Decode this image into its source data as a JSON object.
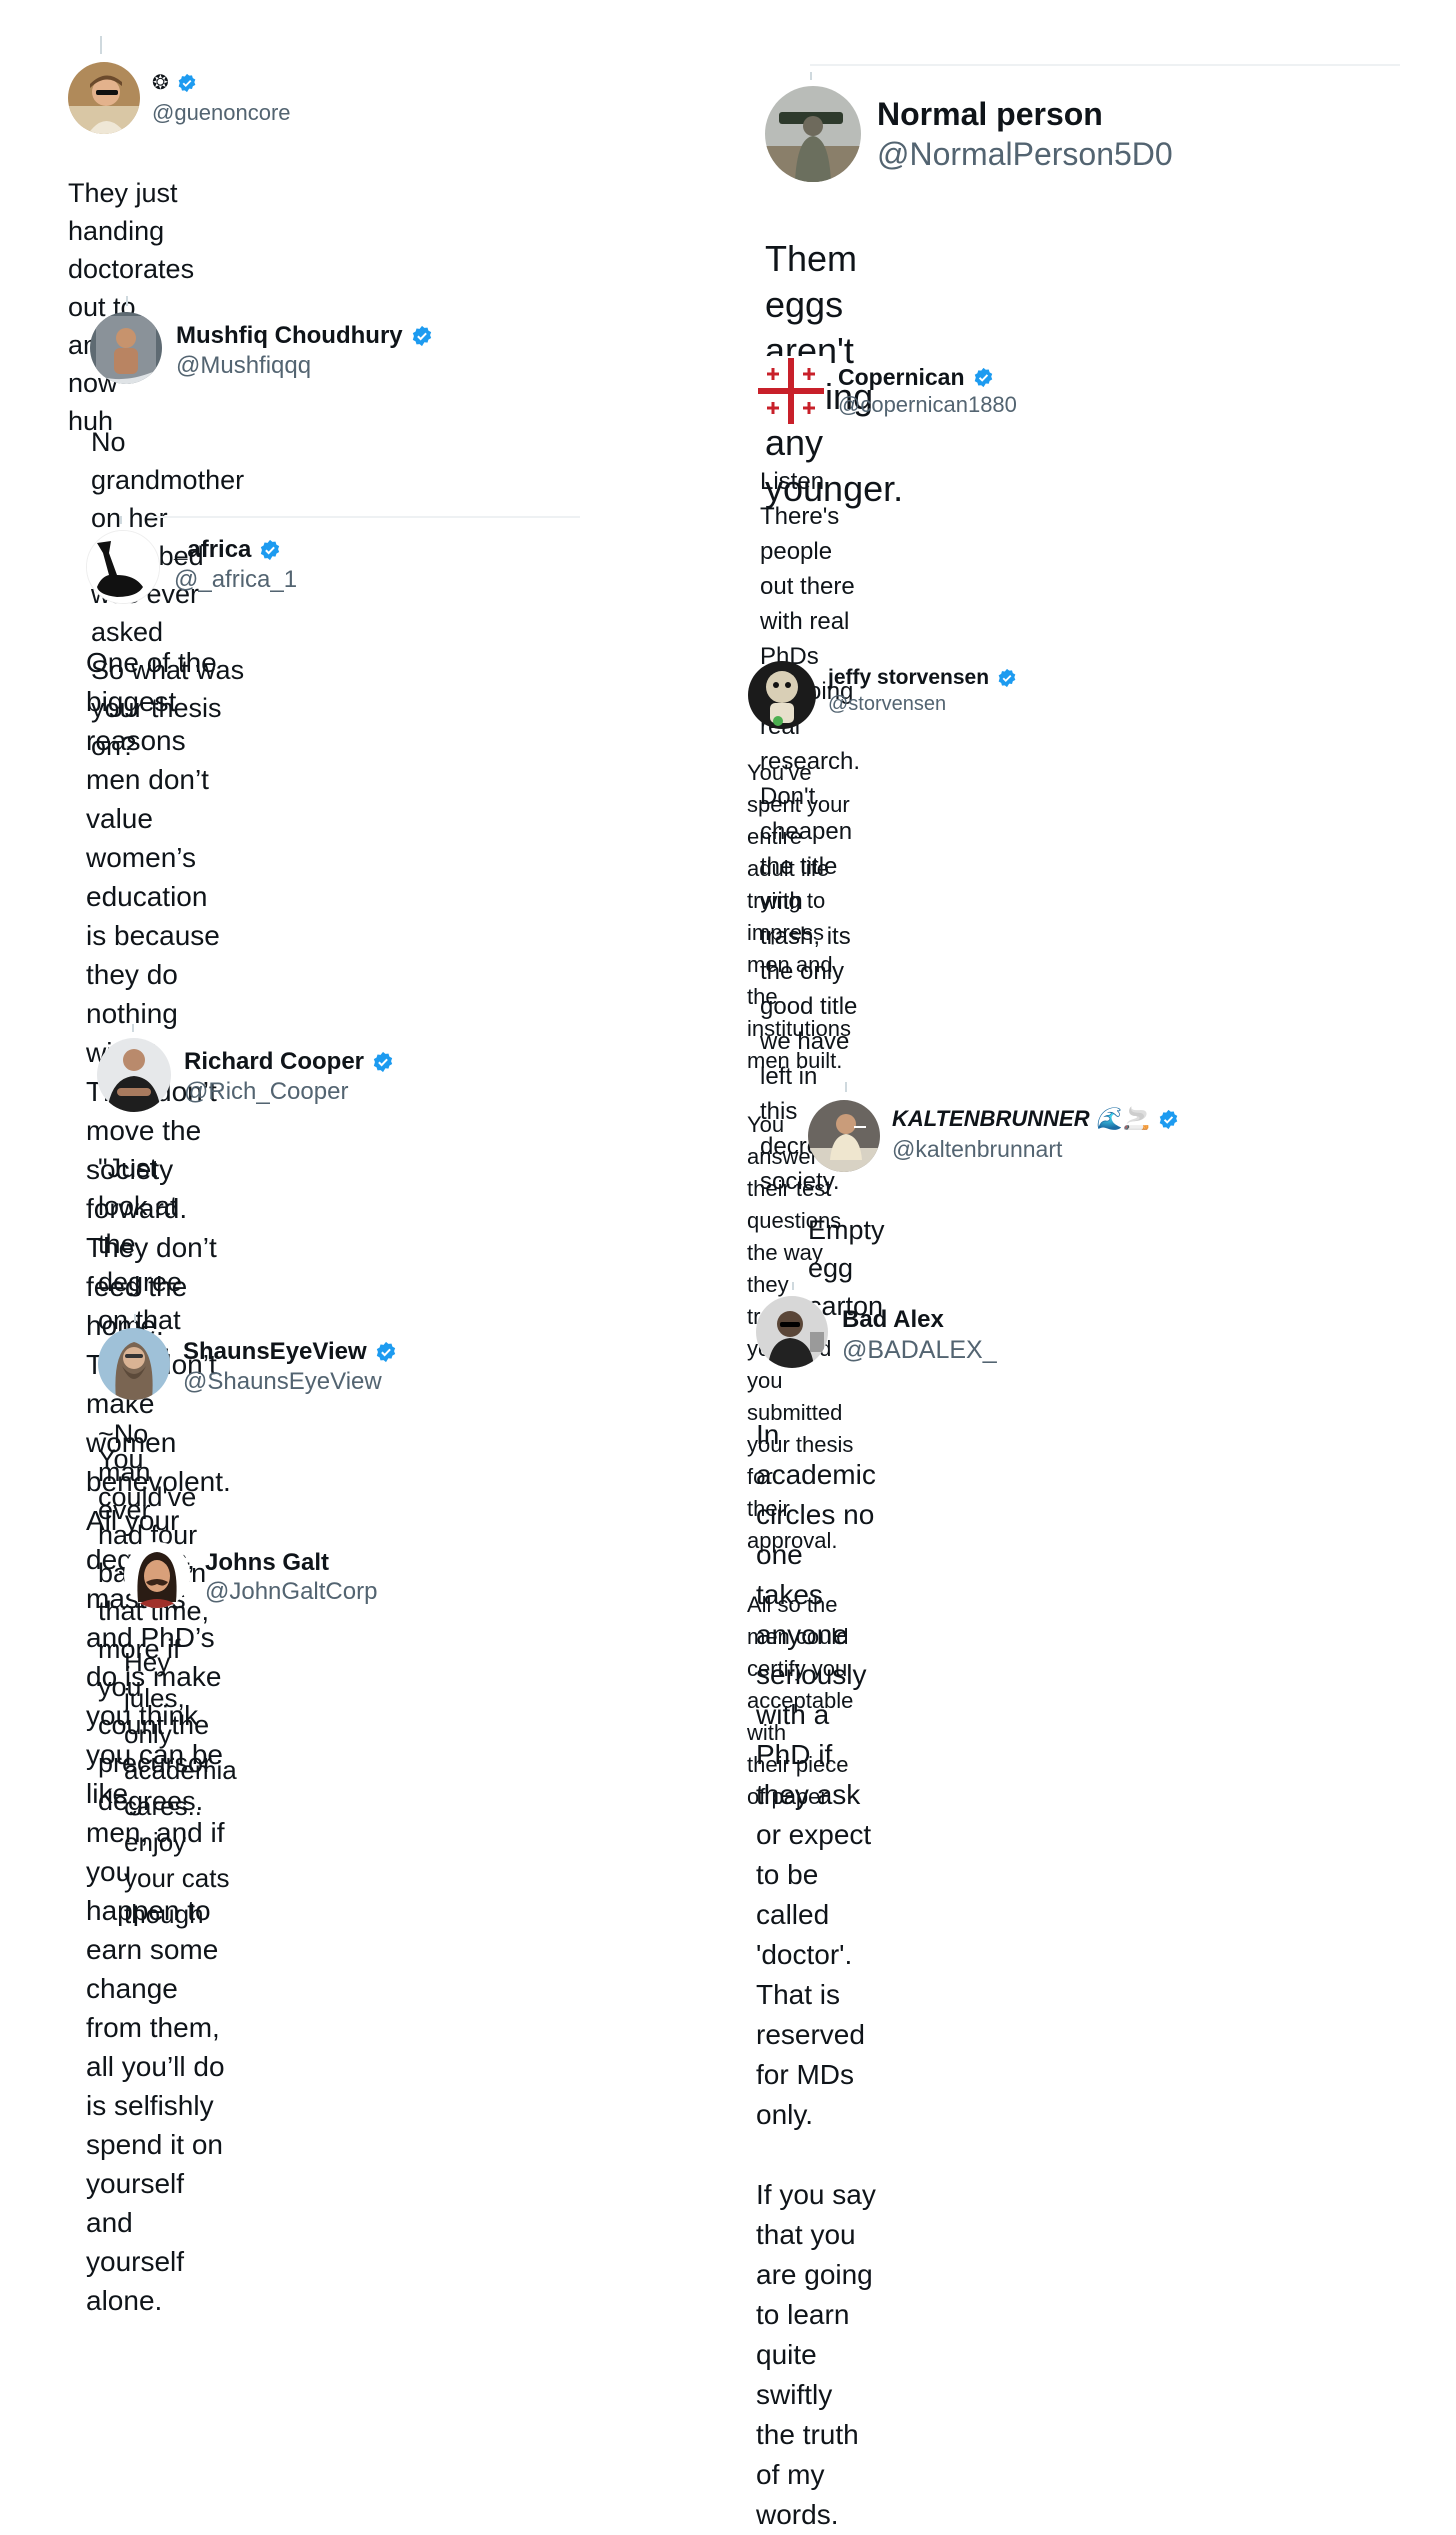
{
  "colors": {
    "verified": "#1d9bf0",
    "text": "#0f1419",
    "handle": "#536471"
  },
  "left_column": [
    {
      "id": "guenoncore",
      "name": "❂",
      "handle": "@guenoncore",
      "verified": true,
      "text": "They just handing doctorates out to anyone now\nhuh",
      "avatar_icon": "person-sunglasses-icon"
    },
    {
      "id": "mushfiq",
      "name": "Mushfiq Choudhury",
      "handle": "@Mushfiqqq",
      "verified": true,
      "text": "No grandmother on her deathbed was ever asked\nSo what was your thesis on?",
      "avatar_icon": "person-mirror-selfie-icon"
    },
    {
      "id": "africa",
      "name": "_africa",
      "handle": "@_africa_1",
      "verified": true,
      "text": "One of the biggest reasons men don’t value\nwomen’s education is because they do nothing\nwith it. They don’t move the society forward.\nThey don’t feed the home. They don’t make\nwomen benevolent. All your degrees, masters\nand PhD’s do is make you think you can be like\nmen, and if you happen to earn some change\nfrom them, all you’ll do is selfishly spend it on\nyourself and yourself alone.",
      "avatar_icon": "silhouette-icon"
    },
    {
      "id": "richard",
      "name": "Richard Cooper",
      "handle": "@Rich_Cooper",
      "verified": true,
      "text": "\"Just look at the degree on that chick\"\n\n~No man ever",
      "avatar_icon": "person-arms-crossed-icon"
    },
    {
      "id": "shaun",
      "name": "ShaunsEyeView",
      "handle": "@ShaunsEyeView",
      "verified": true,
      "text": "You could've had four babies in that time, more if\nyou count the precursor degrees.",
      "avatar_icon": "person-beard-icon"
    },
    {
      "id": "galt",
      "name": "Johns Galt",
      "handle": "@JohnGaltCorp",
      "verified": false,
      "text": "Hey jules, only academia cares.. enjoy your cats\nthough",
      "avatar_icon": "person-mustache-icon"
    }
  ],
  "right_column": [
    {
      "id": "normal",
      "name": "Normal person",
      "handle": "@NormalPerson5D0",
      "verified": false,
      "text": "Them eggs aren't getting any younger.",
      "avatar_icon": "soldier-icon"
    },
    {
      "id": "copernican",
      "name": "Copernican",
      "handle": "@copernican1880",
      "verified": true,
      "text": "Listen. There's people out there with real PhDs\nfor doing real research. Don't cheapen the title\nwith trash, its the only good title we have left in\nthis decrepit society.",
      "avatar_icon": "jerusalem-cross-icon"
    },
    {
      "id": "jeffy",
      "name": "jeffy storvensen",
      "handle": "@storvensen",
      "verified": true,
      "text": "You've spent your entire adult life trying to\nimpress men and the institutions men built.\n\nYou answered their test questions the way they\ntrained you, and you submitted your thesis for\ntheir approval.\n\nAll so the men could certify you acceptable with\ntheir piece of paper.",
      "avatar_icon": "puppet-icon"
    },
    {
      "id": "kalten",
      "name": "KALTENBRUNNER 🌊🚬",
      "handle": "@kaltenbrunnart",
      "verified": true,
      "text": "Empty egg carton",
      "avatar_icon": "person-smoking-icon"
    },
    {
      "id": "badalex",
      "name": "Bad Alex",
      "handle": "@BADALEX_",
      "verified": false,
      "text": "In academic circles no one takes anyone\nseriously with a PhD if they ask or expect to be\ncalled 'doctor'. That is reserved for MDs only.\n\nIf you say that you are going to learn quite swiftly\nthe truth of my words.",
      "avatar_icon": "person-sunglasses-dark-icon"
    }
  ]
}
